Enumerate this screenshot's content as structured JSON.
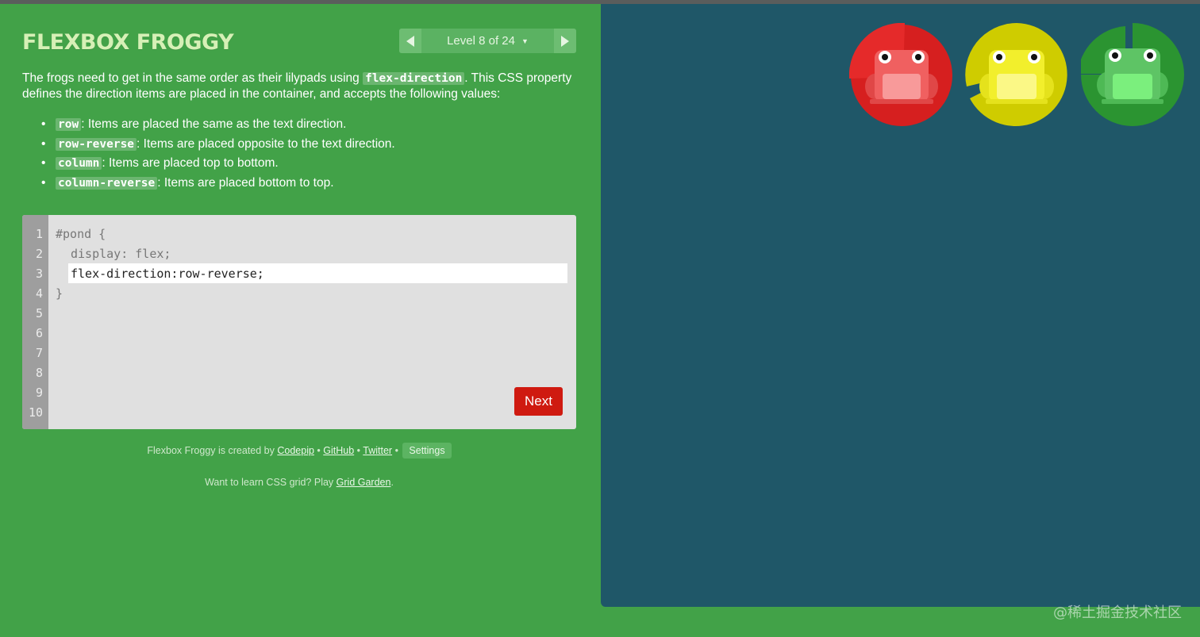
{
  "header": {
    "title": "FLEXBOX FROGGY",
    "level_label": "Level 8 of 24"
  },
  "instructions": {
    "intro_before": "The frogs need to get in the same order as their lilypads using ",
    "intro_keyword": "flex-direction",
    "intro_after": ". This CSS property defines the direction items are placed in the container, and accepts the following values:",
    "values": [
      {
        "keyword": "row",
        "desc": ": Items are placed the same as the text direction."
      },
      {
        "keyword": "row-reverse",
        "desc": ": Items are placed opposite to the text direction."
      },
      {
        "keyword": "column",
        "desc": ": Items are placed top to bottom."
      },
      {
        "keyword": "column-reverse",
        "desc": ": Items are placed bottom to top."
      }
    ]
  },
  "editor": {
    "line_numbers": [
      "1",
      "2",
      "3",
      "4",
      "5",
      "6",
      "7",
      "8",
      "9",
      "10"
    ],
    "line1": "#pond {",
    "line2": "display: flex;",
    "input_value": "flex-direction:row-reverse;",
    "line4": "}",
    "next_label": "Next"
  },
  "footer": {
    "credit_prefix": "Flexbox Froggy is created by ",
    "codepip": "Codepip",
    "github": "GitHub",
    "twitter": "Twitter",
    "sep": " • ",
    "settings": "Settings",
    "grid_prefix": "Want to learn CSS grid? Play ",
    "grid_link": "Grid Garden",
    "grid_suffix": "."
  },
  "pond": {
    "frogs": [
      {
        "color": "green",
        "pad": "#2b9431",
        "body": "#5ec465",
        "belly": "#7bef7d"
      },
      {
        "color": "yellow",
        "pad": "#cfcc00",
        "body": "#f2ef2c",
        "belly": "#fbf886"
      },
      {
        "color": "red",
        "pad": "#d61f1f",
        "body": "#f06060",
        "belly": "#f89a9a"
      }
    ]
  },
  "watermark": "@稀土掘金技术社区",
  "colors": {
    "background": "#42a248",
    "pond": "#1f5768",
    "next_button": "#cf1a10",
    "title": "#d6f0b6"
  }
}
